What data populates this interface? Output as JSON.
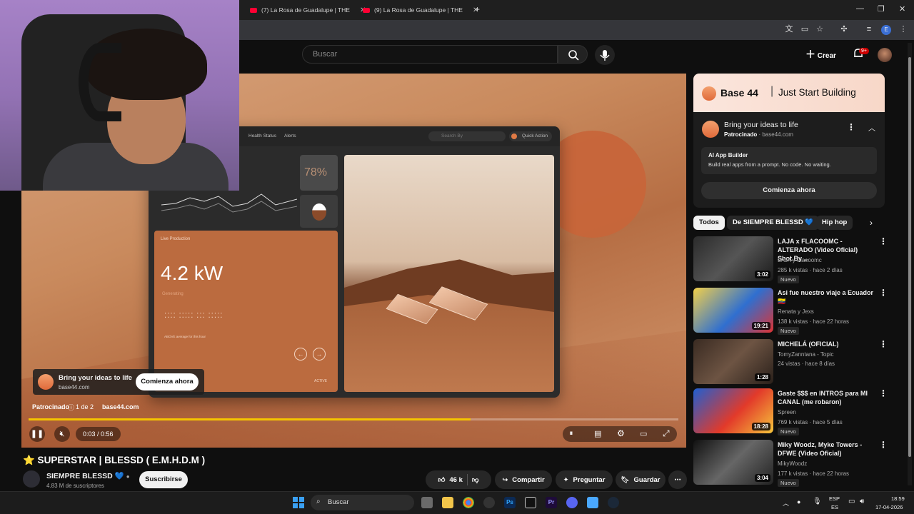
{
  "browser": {
    "tabs": [
      {
        "label": "(7) La Rosa de Guadalupe | THE"
      },
      {
        "label": "(9) La Rosa de Guadalupe | THE"
      }
    ],
    "new_tab": "+"
  },
  "header": {
    "search_placeholder": "Buscar",
    "create_label": "Crear",
    "notifications_badge": "9+"
  },
  "video": {
    "dashboard": {
      "nav_health": "Health Status",
      "nav_alerts": "Alerts",
      "search": "Search By",
      "quick_action": "Quick Action",
      "percent": "78%",
      "live_production": "Live Production",
      "kw": "4.2 kW",
      "generating": "Generating",
      "above_avg": "ABOVE average for this hour",
      "active": "ACTIVE"
    },
    "ad_overlay": {
      "title": "Bring your ideas to life",
      "domain": "base44.com",
      "cta": "Comienza ahora"
    },
    "sponsored": {
      "label": "Patrocinado",
      "count": "1 de 2",
      "domain": "base44.com"
    },
    "time": "0:03 / 0:56",
    "progress_fraction": 0.68
  },
  "below_video": {
    "title": "⭐ SUPERSTAR | BLESSD ( E.M.H.D.M )",
    "channel_name": "SIEMPRE BLESSD",
    "subscribers": "4.83 M de suscriptores",
    "subscribe": "Suscribirse",
    "likes": "46 k",
    "share": "Compartir",
    "ask": "Preguntar",
    "save": "Guardar"
  },
  "sidebar": {
    "ad": {
      "brand": "Base 44",
      "tagline": "Just Start Building",
      "title": "Bring your ideas to life",
      "sponsored": "Patrocinado",
      "domain": "base44.com",
      "inner_title": "AI App Builder",
      "inner_desc": "Build real apps from a prompt. No code. No waiting.",
      "cta": "Comienza ahora"
    },
    "chips": [
      "Todos",
      "De SIEMPRE BLESSD 💙",
      "Hip hop"
    ],
    "recs": [
      {
        "title": "LAJA x FLACOOMC - ALTERADO (Video Oficial) Shot.By ...",
        "channel": "LAJA y Flacoomc",
        "meta": "285 k vistas · hace 2 días",
        "badge": "Nuevo",
        "duration": "3:02"
      },
      {
        "title": "Asi fue nuestro viaje a Ecuador 🇪🇨",
        "channel": "Renata y Jexs",
        "meta": "138 k vistas · hace 22 horas",
        "badge": "Nuevo",
        "duration": "19:21"
      },
      {
        "title": "MICHELÁ (OFICIAL)",
        "channel": "TomyZanntana - Topic",
        "meta": "24 vistas · hace 8 días",
        "badge": "",
        "duration": "1:28"
      },
      {
        "title": "Gaste $$$ en INTROS para MI CANAL (me robaron)",
        "channel": "Spreen",
        "meta": "769 k vistas · hace 5 días",
        "badge": "Nuevo",
        "duration": "18:28"
      },
      {
        "title": "Miky Woodz, Myke Towers - DFWE (Video Oficial)",
        "channel": "MikyWoodz",
        "meta": "177 k vistas · hace 22 horas",
        "badge": "Nuevo",
        "duration": "3:04"
      }
    ]
  },
  "taskbar": {
    "search": "Buscar",
    "lang_top": "ESP",
    "lang_bottom": "ES",
    "time": "18:59",
    "date": "17-04-2026"
  }
}
